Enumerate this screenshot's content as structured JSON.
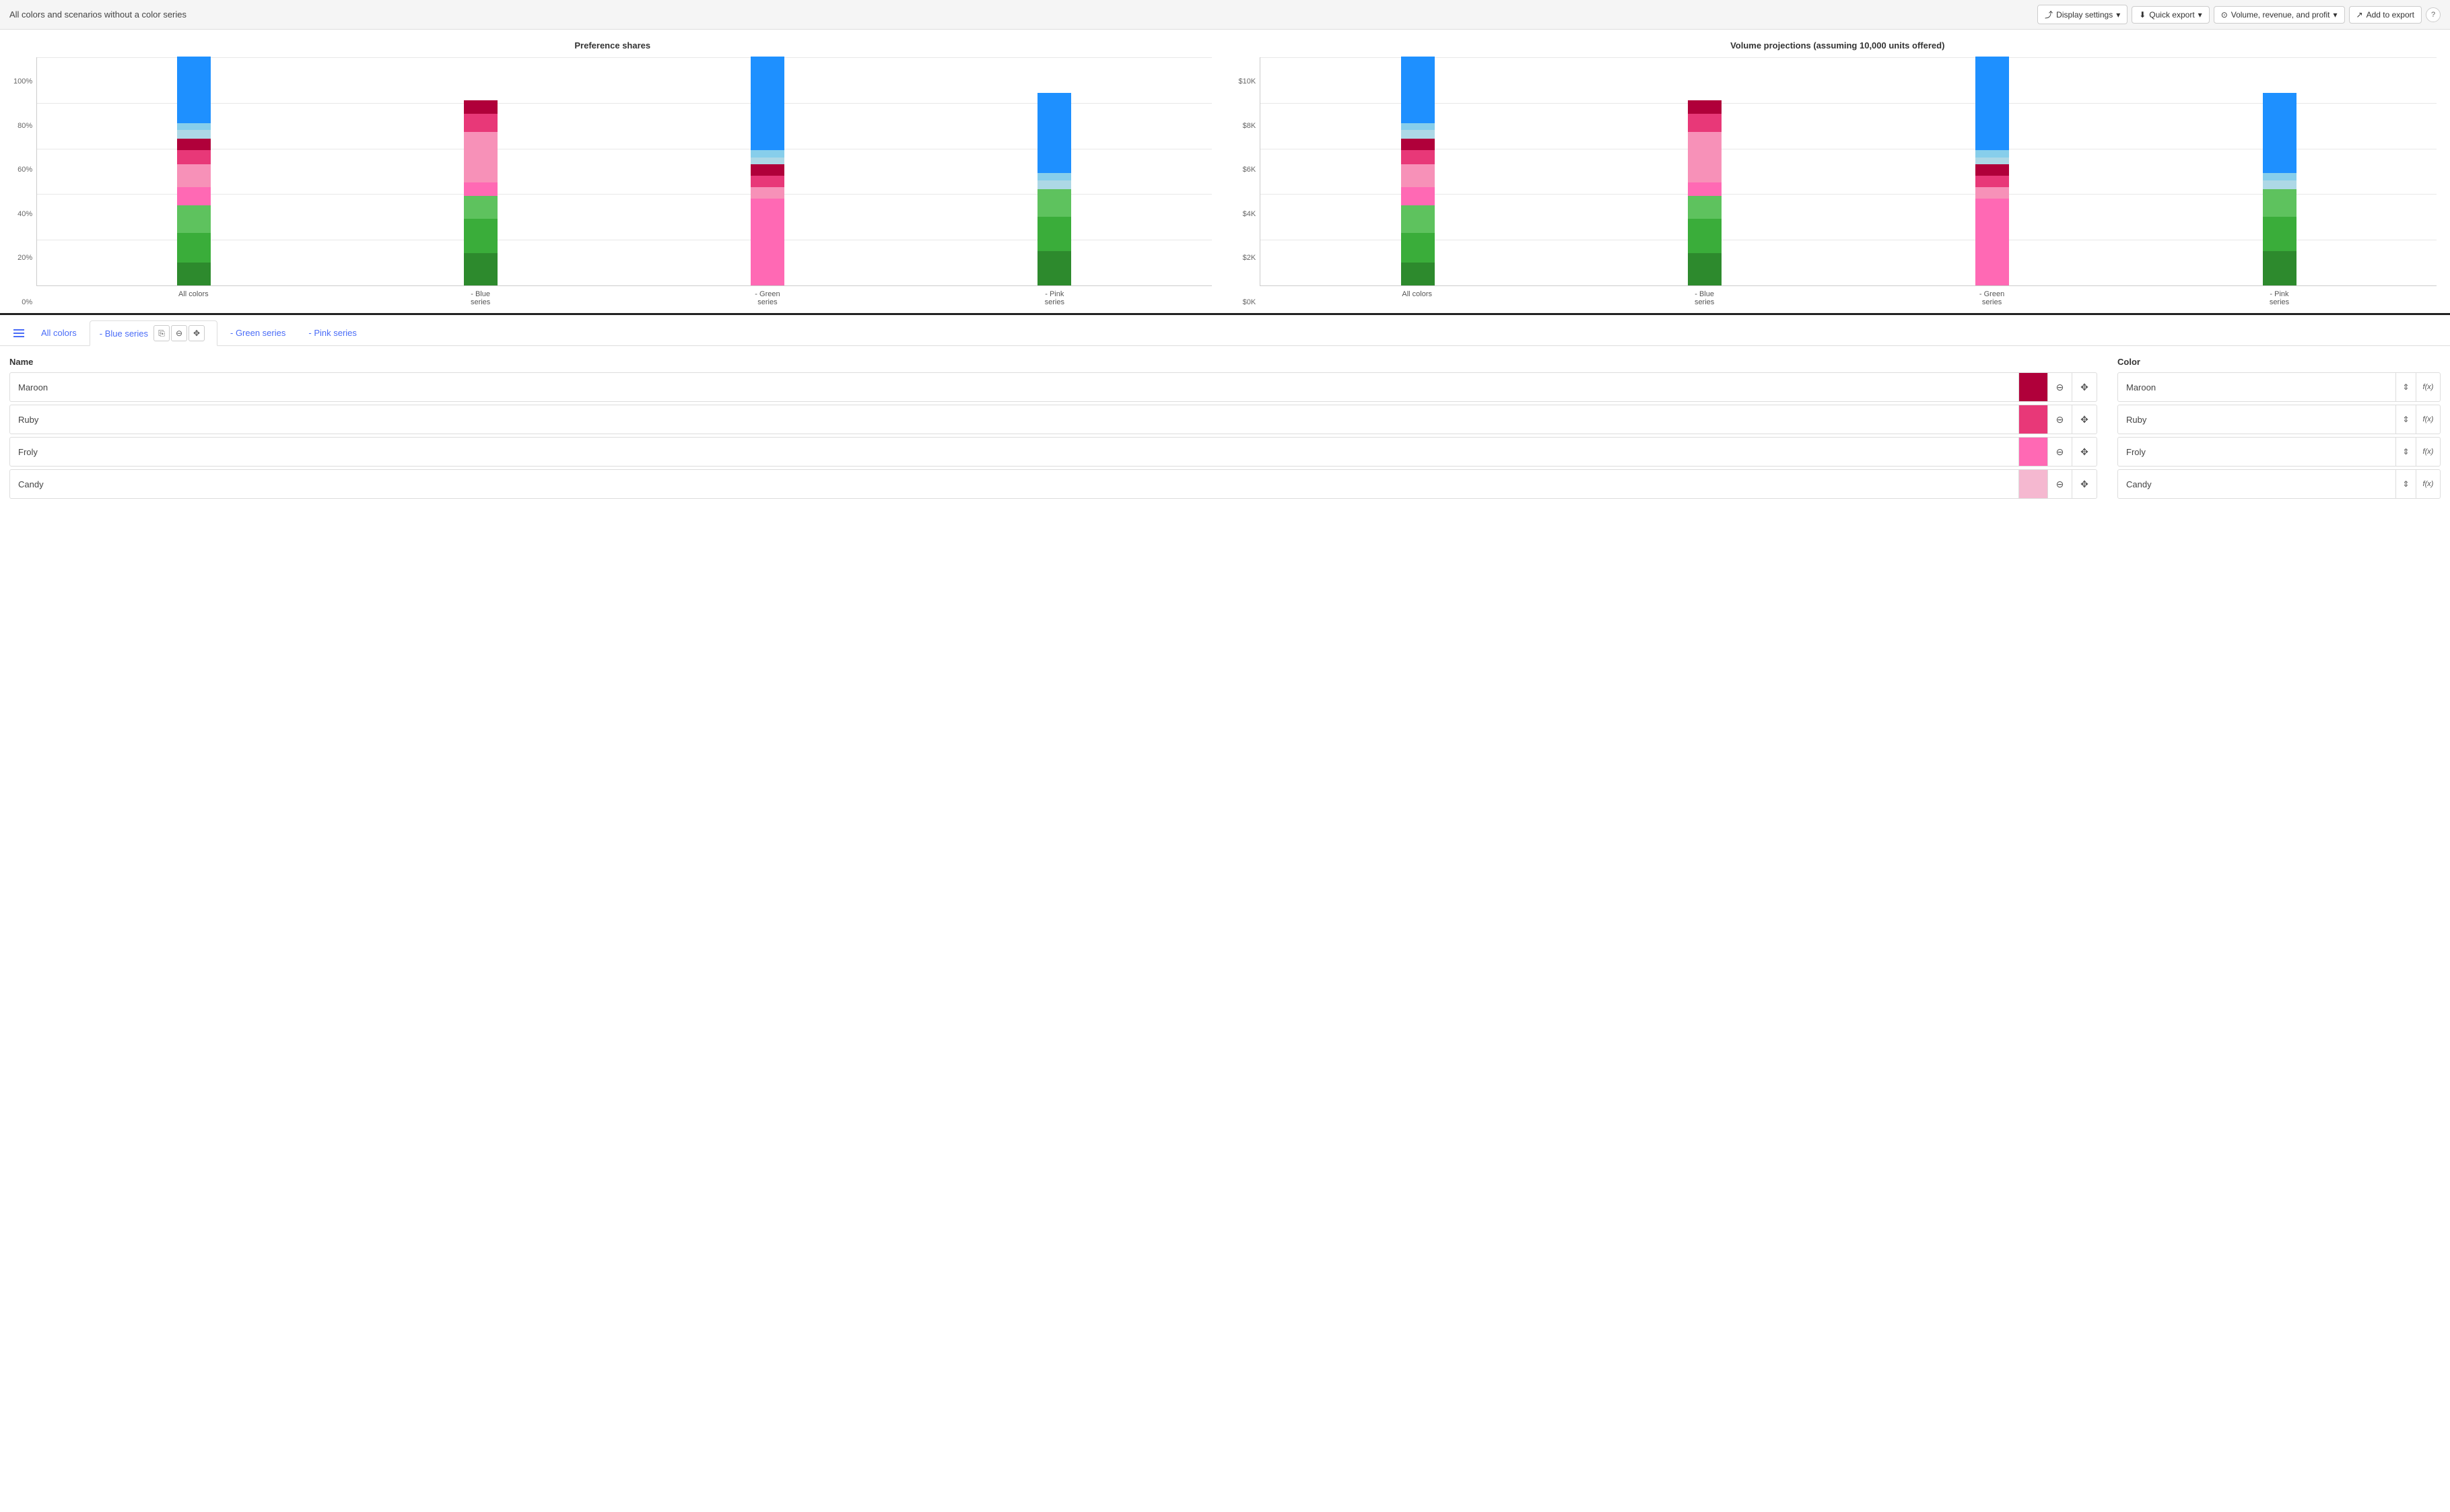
{
  "topBar": {
    "title": "All colors and scenarios without a color series",
    "buttons": {
      "displaySettings": "Display settings",
      "quickExport": "Quick export",
      "volumeRevenue": "Volume, revenue, and profit",
      "addToExport": "Add to export"
    }
  },
  "charts": {
    "left": {
      "title": "Preference shares",
      "yLabels": [
        "100%",
        "80%",
        "60%",
        "40%",
        "20%",
        "0%"
      ],
      "xLabels": [
        "All colors",
        "- Blue series",
        "- Green series",
        "- Pink series"
      ],
      "bars": [
        {
          "label": "All colors",
          "segments": [
            {
              "color": "#2d8a2d",
              "height": 10
            },
            {
              "color": "#3aad3a",
              "height": 13
            },
            {
              "color": "#5ec25e",
              "height": 12
            },
            {
              "color": "#ff69b4",
              "height": 8
            },
            {
              "color": "#f791b8",
              "height": 10
            },
            {
              "color": "#e83878",
              "height": 6
            },
            {
              "color": "#b0003a",
              "height": 5
            },
            {
              "color": "#add8e6",
              "height": 4
            },
            {
              "color": "#87ceeb",
              "height": 3
            },
            {
              "color": "#1e90ff",
              "height": 29
            }
          ]
        },
        {
          "label": "- Blue series",
          "segments": [
            {
              "color": "#2d8a2d",
              "height": 14
            },
            {
              "color": "#3aad3a",
              "height": 15
            },
            {
              "color": "#5ec25e",
              "height": 10
            },
            {
              "color": "#ff69b4",
              "height": 6
            },
            {
              "color": "#f791b8",
              "height": 22
            },
            {
              "color": "#e83878",
              "height": 8
            },
            {
              "color": "#b0003a",
              "height": 6
            },
            {
              "color": "#add8e6",
              "height": 0
            },
            {
              "color": "#87ceeb",
              "height": 0
            },
            {
              "color": "#1e90ff",
              "height": 0
            }
          ]
        },
        {
          "label": "- Green series",
          "segments": [
            {
              "color": "#2d8a2d",
              "height": 0
            },
            {
              "color": "#3aad3a",
              "height": 0
            },
            {
              "color": "#5ec25e",
              "height": 0
            },
            {
              "color": "#ff69b4",
              "height": 38
            },
            {
              "color": "#f791b8",
              "height": 5
            },
            {
              "color": "#e83878",
              "height": 5
            },
            {
              "color": "#b0003a",
              "height": 5
            },
            {
              "color": "#add8e6",
              "height": 3
            },
            {
              "color": "#87ceeb",
              "height": 3
            },
            {
              "color": "#1e90ff",
              "height": 41
            }
          ]
        },
        {
          "label": "- Pink series",
          "segments": [
            {
              "color": "#2d8a2d",
              "height": 15
            },
            {
              "color": "#3aad3a",
              "height": 15
            },
            {
              "color": "#5ec25e",
              "height": 12
            },
            {
              "color": "#ff69b4",
              "height": 0
            },
            {
              "color": "#f791b8",
              "height": 0
            },
            {
              "color": "#e83878",
              "height": 0
            },
            {
              "color": "#b0003a",
              "height": 0
            },
            {
              "color": "#add8e6",
              "height": 4
            },
            {
              "color": "#87ceeb",
              "height": 3
            },
            {
              "color": "#1e90ff",
              "height": 35
            }
          ]
        }
      ]
    },
    "right": {
      "title": "Volume projections (assuming 10,000 units offered)",
      "yLabels": [
        "$10K",
        "$8K",
        "$6K",
        "$4K",
        "$2K",
        "$0K"
      ],
      "xLabels": [
        "All colors",
        "- Blue series",
        "- Green series",
        "- Pink series"
      ],
      "bars": [
        {
          "label": "All colors",
          "segments": [
            {
              "color": "#2d8a2d",
              "height": 10
            },
            {
              "color": "#3aad3a",
              "height": 13
            },
            {
              "color": "#5ec25e",
              "height": 12
            },
            {
              "color": "#ff69b4",
              "height": 8
            },
            {
              "color": "#f791b8",
              "height": 10
            },
            {
              "color": "#e83878",
              "height": 6
            },
            {
              "color": "#b0003a",
              "height": 5
            },
            {
              "color": "#add8e6",
              "height": 4
            },
            {
              "color": "#87ceeb",
              "height": 3
            },
            {
              "color": "#1e90ff",
              "height": 29
            }
          ]
        },
        {
          "label": "- Blue series",
          "segments": [
            {
              "color": "#2d8a2d",
              "height": 14
            },
            {
              "color": "#3aad3a",
              "height": 15
            },
            {
              "color": "#5ec25e",
              "height": 10
            },
            {
              "color": "#ff69b4",
              "height": 6
            },
            {
              "color": "#f791b8",
              "height": 22
            },
            {
              "color": "#e83878",
              "height": 8
            },
            {
              "color": "#b0003a",
              "height": 6
            },
            {
              "color": "#add8e6",
              "height": 0
            },
            {
              "color": "#87ceeb",
              "height": 0
            },
            {
              "color": "#1e90ff",
              "height": 0
            }
          ]
        },
        {
          "label": "- Green series",
          "segments": [
            {
              "color": "#2d8a2d",
              "height": 0
            },
            {
              "color": "#3aad3a",
              "height": 0
            },
            {
              "color": "#5ec25e",
              "height": 0
            },
            {
              "color": "#ff69b4",
              "height": 38
            },
            {
              "color": "#f791b8",
              "height": 5
            },
            {
              "color": "#e83878",
              "height": 5
            },
            {
              "color": "#b0003a",
              "height": 5
            },
            {
              "color": "#add8e6",
              "height": 3
            },
            {
              "color": "#87ceeb",
              "height": 3
            },
            {
              "color": "#1e90ff",
              "height": 41
            }
          ]
        },
        {
          "label": "- Pink series",
          "segments": [
            {
              "color": "#2d8a2d",
              "height": 15
            },
            {
              "color": "#3aad3a",
              "height": 15
            },
            {
              "color": "#5ec25e",
              "height": 12
            },
            {
              "color": "#ff69b4",
              "height": 0
            },
            {
              "color": "#f791b8",
              "height": 0
            },
            {
              "color": "#e83878",
              "height": 0
            },
            {
              "color": "#b0003a",
              "height": 0
            },
            {
              "color": "#add8e6",
              "height": 4
            },
            {
              "color": "#87ceeb",
              "height": 3
            },
            {
              "color": "#1e90ff",
              "height": 35
            }
          ]
        }
      ]
    }
  },
  "tabs": {
    "items": [
      {
        "label": "All colors",
        "active": false
      },
      {
        "label": "- Blue series",
        "active": true
      },
      {
        "label": "- Green series",
        "active": false
      },
      {
        "label": "- Pink series",
        "active": false
      }
    ]
  },
  "dataSection": {
    "nameHeader": "Name",
    "colorHeader": "Color",
    "rows": [
      {
        "name": "Maroon",
        "swatchColor": "#b0003a",
        "colorName": "Maroon"
      },
      {
        "name": "Ruby",
        "swatchColor": "#e83878",
        "colorName": "Ruby"
      },
      {
        "name": "Froly",
        "swatchColor": "#ff69b4",
        "colorName": "Froly"
      },
      {
        "name": "Candy",
        "swatchColor": "#f5b8d0",
        "colorName": "Candy"
      }
    ]
  }
}
